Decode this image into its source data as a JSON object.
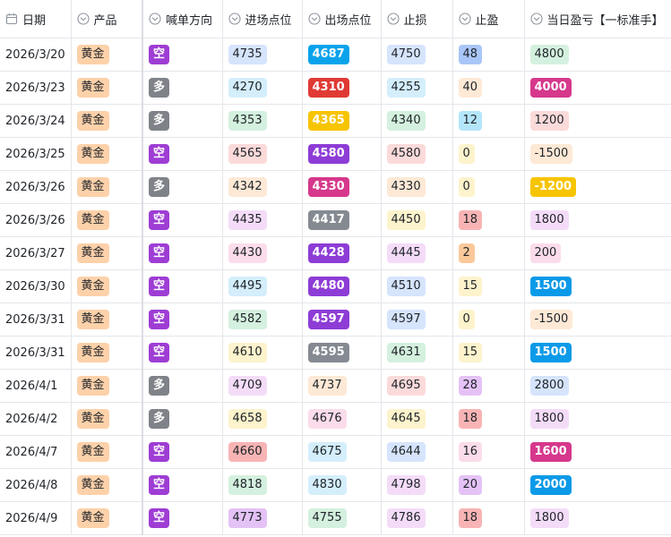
{
  "columns": [
    {
      "label": "日期",
      "icon": "calendar-icon"
    },
    {
      "label": "产品",
      "icon": "dropdown-circle-icon"
    },
    {
      "label": "喊单方向",
      "icon": "dropdown-circle-icon"
    },
    {
      "label": "进场点位",
      "icon": "dropdown-circle-icon"
    },
    {
      "label": "出场点位",
      "icon": "dropdown-circle-icon"
    },
    {
      "label": "止损",
      "icon": "dropdown-circle-icon"
    },
    {
      "label": "止盈",
      "icon": "dropdown-circle-icon"
    },
    {
      "label": "当日盈亏【一标准手】",
      "icon": "dropdown-circle-icon"
    }
  ],
  "palette": {
    "blue": {
      "bg": "#d6e4fc",
      "fg": "#1f2329"
    },
    "lightblue": {
      "bg": "#d4eefb",
      "fg": "#1f2329"
    },
    "green": {
      "bg": "#d4f0de",
      "fg": "#1f2329"
    },
    "red": {
      "bg": "#fbdada",
      "fg": "#1f2329"
    },
    "pink": {
      "bg": "#fbdcea",
      "fg": "#1f2329"
    },
    "lavender": {
      "bg": "#f4dcf8",
      "fg": "#1f2329"
    },
    "peach": {
      "bg": "#fde9d6",
      "fg": "#1f2329"
    },
    "yellow": {
      "bg": "#fdf3cc",
      "fg": "#1f2329"
    },
    "orange": {
      "bg": "#fdd1a9",
      "fg": "#1f2329"
    },
    "strongblue": {
      "bg": "#a9c6f8",
      "fg": "#1f2329"
    },
    "salmon": {
      "bg": "#f8b4b4",
      "fg": "#1f2329"
    },
    "strongorange": {
      "bg": "#fbc89a",
      "fg": "#1f2329"
    },
    "purple": {
      "bg": "#e4c2f6",
      "fg": "#1f2329"
    },
    "cyan": {
      "bg": "#b4e6fa",
      "fg": "#1f2329"
    },
    "solidcyan": {
      "bg": "#0aa3eb",
      "fg": "#ffffff"
    },
    "solidred": {
      "bg": "#e03a35",
      "fg": "#ffffff"
    },
    "solidyellow": {
      "bg": "#f7c400",
      "fg": "#ffffff"
    },
    "solidpurple": {
      "bg": "#8e3cd6",
      "fg": "#ffffff"
    },
    "solidmagenta": {
      "bg": "#d6388c",
      "fg": "#ffffff"
    },
    "solidgray": {
      "bg": "#858a92",
      "fg": "#ffffff"
    },
    "solidblue": {
      "bg": "#0b9ae8",
      "fg": "#ffffff"
    },
    "direction_short": {
      "bg": "#9e3dd4",
      "fg": "#ffffff"
    },
    "direction_long": {
      "bg": "#7f8389",
      "fg": "#ffffff"
    }
  },
  "rows": [
    {
      "date": "2026/3/20",
      "product": "黄金",
      "direction": "空",
      "dir_color": "direction_short",
      "entry": {
        "text": "4735",
        "color": "blue"
      },
      "exit": {
        "text": "4687",
        "color": "solidcyan"
      },
      "stop_loss": {
        "text": "4750",
        "color": "blue"
      },
      "take_profit": {
        "text": "48",
        "color": "strongblue"
      },
      "pnl": {
        "text": "4800",
        "color": "green"
      }
    },
    {
      "date": "2026/3/23",
      "product": "黄金",
      "direction": "多",
      "dir_color": "direction_long",
      "entry": {
        "text": "4270",
        "color": "lightblue"
      },
      "exit": {
        "text": "4310",
        "color": "solidred"
      },
      "stop_loss": {
        "text": "4255",
        "color": "lightblue"
      },
      "take_profit": {
        "text": "40",
        "color": "peach"
      },
      "pnl": {
        "text": "4000",
        "color": "solidmagenta"
      }
    },
    {
      "date": "2026/3/24",
      "product": "黄金",
      "direction": "多",
      "dir_color": "direction_long",
      "entry": {
        "text": "4353",
        "color": "green"
      },
      "exit": {
        "text": "4365",
        "color": "solidyellow"
      },
      "stop_loss": {
        "text": "4340",
        "color": "green"
      },
      "take_profit": {
        "text": "12",
        "color": "cyan"
      },
      "pnl": {
        "text": "1200",
        "color": "red"
      }
    },
    {
      "date": "2026/3/25",
      "product": "黄金",
      "direction": "空",
      "dir_color": "direction_short",
      "entry": {
        "text": "4565",
        "color": "red"
      },
      "exit": {
        "text": "4580",
        "color": "solidpurple"
      },
      "stop_loss": {
        "text": "4580",
        "color": "red"
      },
      "take_profit": {
        "text": "0",
        "color": "yellow"
      },
      "pnl": {
        "text": "-1500",
        "color": "peach"
      }
    },
    {
      "date": "2026/3/26",
      "product": "黄金",
      "direction": "多",
      "dir_color": "direction_long",
      "entry": {
        "text": "4342",
        "color": "peach"
      },
      "exit": {
        "text": "4330",
        "color": "solidmagenta"
      },
      "stop_loss": {
        "text": "4330",
        "color": "peach"
      },
      "take_profit": {
        "text": "0",
        "color": "yellow"
      },
      "pnl": {
        "text": "-1200",
        "color": "solidyellow"
      }
    },
    {
      "date": "2026/3/26",
      "product": "黄金",
      "direction": "空",
      "dir_color": "direction_short",
      "entry": {
        "text": "4435",
        "color": "lavender"
      },
      "exit": {
        "text": "4417",
        "color": "solidgray"
      },
      "stop_loss": {
        "text": "4450",
        "color": "yellow"
      },
      "take_profit": {
        "text": "18",
        "color": "salmon"
      },
      "pnl": {
        "text": "1800",
        "color": "lavender"
      }
    },
    {
      "date": "2026/3/27",
      "product": "黄金",
      "direction": "空",
      "dir_color": "direction_short",
      "entry": {
        "text": "4430",
        "color": "pink"
      },
      "exit": {
        "text": "4428",
        "color": "solidpurple"
      },
      "stop_loss": {
        "text": "4445",
        "color": "lavender"
      },
      "take_profit": {
        "text": "2",
        "color": "strongorange"
      },
      "pnl": {
        "text": "200",
        "color": "pink"
      }
    },
    {
      "date": "2026/3/30",
      "product": "黄金",
      "direction": "空",
      "dir_color": "direction_short",
      "entry": {
        "text": "4495",
        "color": "lightblue"
      },
      "exit": {
        "text": "4480",
        "color": "solidpurple"
      },
      "stop_loss": {
        "text": "4510",
        "color": "blue"
      },
      "take_profit": {
        "text": "15",
        "color": "yellow"
      },
      "pnl": {
        "text": "1500",
        "color": "solidblue"
      }
    },
    {
      "date": "2026/3/31",
      "product": "黄金",
      "direction": "空",
      "dir_color": "direction_short",
      "entry": {
        "text": "4582",
        "color": "green"
      },
      "exit": {
        "text": "4597",
        "color": "solidpurple"
      },
      "stop_loss": {
        "text": "4597",
        "color": "blue"
      },
      "take_profit": {
        "text": "0",
        "color": "yellow"
      },
      "pnl": {
        "text": "-1500",
        "color": "peach"
      }
    },
    {
      "date": "2026/3/31",
      "product": "黄金",
      "direction": "空",
      "dir_color": "direction_short",
      "entry": {
        "text": "4610",
        "color": "yellow"
      },
      "exit": {
        "text": "4595",
        "color": "solidgray"
      },
      "stop_loss": {
        "text": "4631",
        "color": "green"
      },
      "take_profit": {
        "text": "15",
        "color": "yellow"
      },
      "pnl": {
        "text": "1500",
        "color": "solidblue"
      }
    },
    {
      "date": "2026/4/1",
      "product": "黄金",
      "direction": "多",
      "dir_color": "direction_long",
      "entry": {
        "text": "4709",
        "color": "lavender"
      },
      "exit": {
        "text": "4737",
        "color": "peach"
      },
      "stop_loss": {
        "text": "4695",
        "color": "red"
      },
      "take_profit": {
        "text": "28",
        "color": "purple"
      },
      "pnl": {
        "text": "2800",
        "color": "blue"
      }
    },
    {
      "date": "2026/4/2",
      "product": "黄金",
      "direction": "多",
      "dir_color": "direction_long",
      "entry": {
        "text": "4658",
        "color": "yellow"
      },
      "exit": {
        "text": "4676",
        "color": "pink"
      },
      "stop_loss": {
        "text": "4645",
        "color": "yellow"
      },
      "take_profit": {
        "text": "18",
        "color": "salmon"
      },
      "pnl": {
        "text": "1800",
        "color": "lavender"
      }
    },
    {
      "date": "2026/4/7",
      "product": "黄金",
      "direction": "空",
      "dir_color": "direction_short",
      "entry": {
        "text": "4660",
        "color": "salmon"
      },
      "exit": {
        "text": "4675",
        "color": "lightblue"
      },
      "stop_loss": {
        "text": "4644",
        "color": "blue"
      },
      "take_profit": {
        "text": "16",
        "color": "pink"
      },
      "pnl": {
        "text": "1600",
        "color": "solidmagenta"
      }
    },
    {
      "date": "2026/4/8",
      "product": "黄金",
      "direction": "空",
      "dir_color": "direction_short",
      "entry": {
        "text": "4818",
        "color": "green"
      },
      "exit": {
        "text": "4830",
        "color": "lightblue"
      },
      "stop_loss": {
        "text": "4798",
        "color": "lavender"
      },
      "take_profit": {
        "text": "20",
        "color": "purple"
      },
      "pnl": {
        "text": "2000",
        "color": "solidblue"
      }
    },
    {
      "date": "2026/4/9",
      "product": "黄金",
      "direction": "空",
      "dir_color": "direction_short",
      "entry": {
        "text": "4773",
        "color": "purple"
      },
      "exit": {
        "text": "4755",
        "color": "green"
      },
      "stop_loss": {
        "text": "4786",
        "color": "lavender"
      },
      "take_profit": {
        "text": "18",
        "color": "salmon"
      },
      "pnl": {
        "text": "1800",
        "color": "lavender"
      }
    }
  ],
  "product_color": "orange"
}
